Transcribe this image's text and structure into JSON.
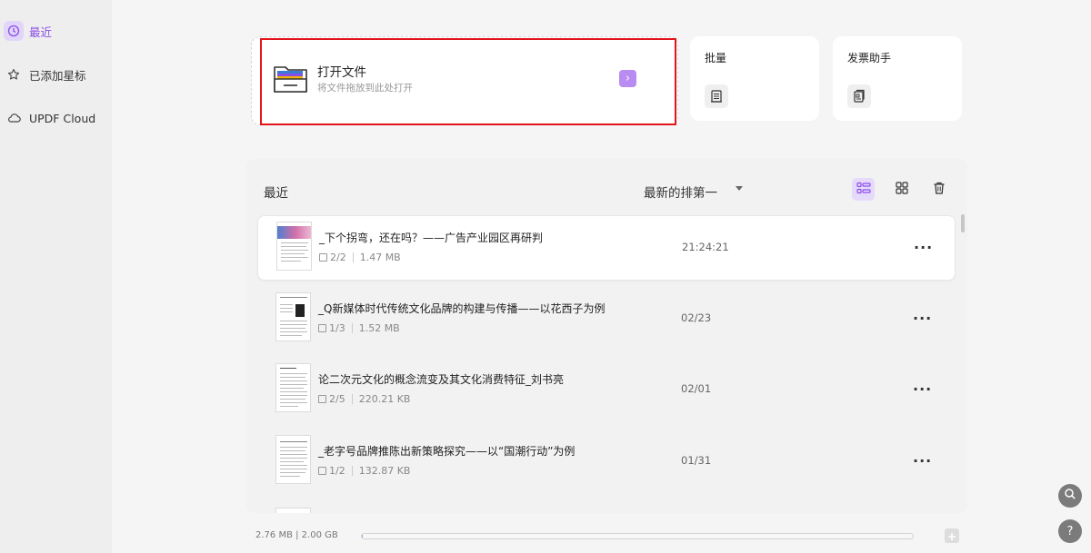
{
  "sidebar": {
    "items": [
      {
        "label": "最近",
        "icon": "clock-icon",
        "active": true
      },
      {
        "label": "已添加星标",
        "icon": "star-icon",
        "active": false
      },
      {
        "label": "UPDF Cloud",
        "icon": "cloud-icon",
        "active": false
      }
    ]
  },
  "open_file": {
    "title": "打开文件",
    "subtitle": "将文件拖放到此处打开",
    "arrow": "›"
  },
  "tools": {
    "batch": {
      "label": "批量",
      "icon": "batch-icon"
    },
    "invoice": {
      "label": "发票助手",
      "icon": "invoice-icon"
    }
  },
  "recent": {
    "title": "最近",
    "sort_label": "最新的排第一",
    "view_modes": [
      "list-view-icon",
      "grid-view-icon",
      "trash-icon"
    ],
    "files": [
      {
        "name": "_下个拐弯，还在吗？——广告产业园区再研判",
        "pages": "2/2",
        "size": "1.47 MB",
        "time": "21:24:21"
      },
      {
        "name": "_Q新媒体时代传统文化品牌的构建与传播——以花西子为例",
        "pages": "1/3",
        "size": "1.52 MB",
        "time": "02/23"
      },
      {
        "name": "论二次元文化的概念流变及其文化消费特征_刘书亮",
        "pages": "2/5",
        "size": "220.21 KB",
        "time": "02/01"
      },
      {
        "name": "_老字号品牌推陈出新策略探究——以“国潮行动”为例",
        "pages": "1/2",
        "size": "132.87 KB",
        "time": "01/31"
      }
    ],
    "more_label": "···"
  },
  "storage": {
    "text": "2.76 MB | 2.00 GB",
    "used_fraction": 0.0013
  },
  "colors": {
    "accent": "#8a4ee8",
    "highlight_frame": "#e2141c"
  }
}
